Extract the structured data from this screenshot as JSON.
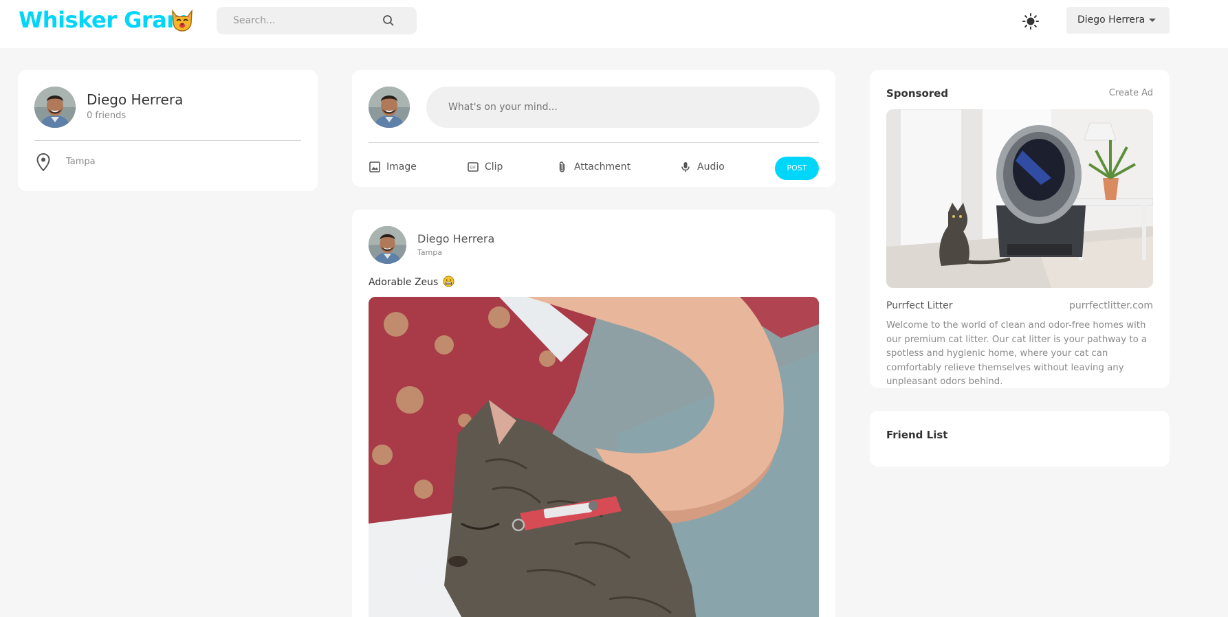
{
  "brand": {
    "name": "Whisker Gram",
    "accent": "#00d5fa"
  },
  "header": {
    "search_placeholder": "Search...",
    "user_name": "Diego Herrera",
    "theme_icon": "sun-icon"
  },
  "profile": {
    "name": "Diego Herrera",
    "friends": "0 friends",
    "location": "Tampa"
  },
  "composer": {
    "placeholder": "What's on your mind...",
    "actions": {
      "image": "Image",
      "clip": "Clip",
      "attachment": "Attachment",
      "audio": "Audio"
    },
    "post_label": "POST"
  },
  "post": {
    "author": "Diego Herrera",
    "location": "Tampa",
    "caption": "Adorable Zeus"
  },
  "sponsored": {
    "title": "Sponsored",
    "create_ad": "Create Ad",
    "name": "Purrfect Litter",
    "site": "purrfectlitter.com",
    "description": "Welcome to the world of clean and odor-free homes with our premium cat litter. Our cat litter is your pathway to a spotless and hygienic home, where your cat can comfortably relieve themselves without leaving any unpleasant odors behind."
  },
  "friend_list": {
    "title": "Friend List"
  }
}
